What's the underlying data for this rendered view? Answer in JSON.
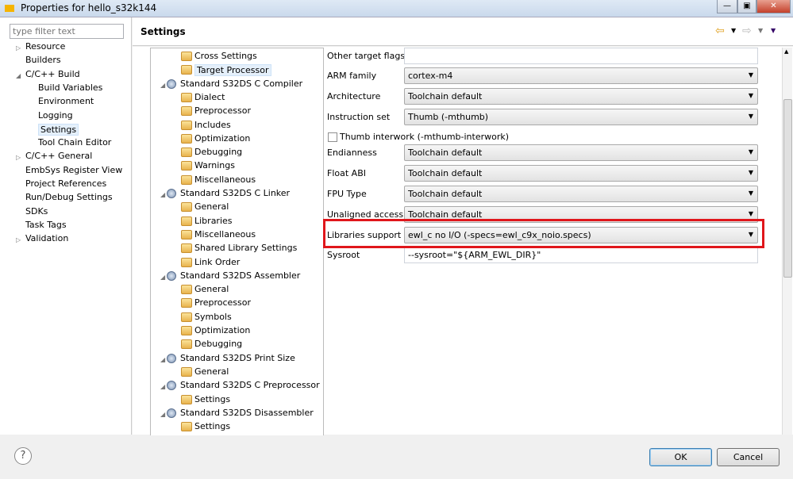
{
  "window": {
    "title": "Properties for hello_s32k144",
    "logo": "NXP"
  },
  "filter": {
    "placeholder": "type filter text"
  },
  "nav": [
    {
      "label": "Resource",
      "level": 0,
      "arrow": "▷"
    },
    {
      "label": "Builders",
      "level": 0,
      "arrow": ""
    },
    {
      "label": "C/C++ Build",
      "level": 0,
      "arrow": "◢"
    },
    {
      "label": "Build Variables",
      "level": 1,
      "arrow": ""
    },
    {
      "label": "Environment",
      "level": 1,
      "arrow": ""
    },
    {
      "label": "Logging",
      "level": 1,
      "arrow": ""
    },
    {
      "label": "Settings",
      "level": 1,
      "arrow": "",
      "selected": true
    },
    {
      "label": "Tool Chain Editor",
      "level": 1,
      "arrow": ""
    },
    {
      "label": "C/C++ General",
      "level": 0,
      "arrow": "▷"
    },
    {
      "label": "EmbSys Register View",
      "level": 0,
      "arrow": ""
    },
    {
      "label": "Project References",
      "level": 0,
      "arrow": ""
    },
    {
      "label": "Run/Debug Settings",
      "level": 0,
      "arrow": ""
    },
    {
      "label": "SDKs",
      "level": 0,
      "arrow": ""
    },
    {
      "label": "Task Tags",
      "level": 0,
      "arrow": ""
    },
    {
      "label": "Validation",
      "level": 0,
      "arrow": "▷"
    }
  ],
  "header": {
    "title": "Settings"
  },
  "tool_tree": [
    {
      "label": "Cross Settings",
      "level": 1,
      "icon": "folder"
    },
    {
      "label": "Target Processor",
      "level": 1,
      "icon": "folder",
      "selected": true
    },
    {
      "label": "Standard S32DS C Compiler",
      "level": 0,
      "icon": "tool"
    },
    {
      "label": "Dialect",
      "level": 1,
      "icon": "folder"
    },
    {
      "label": "Preprocessor",
      "level": 1,
      "icon": "folder"
    },
    {
      "label": "Includes",
      "level": 1,
      "icon": "folder"
    },
    {
      "label": "Optimization",
      "level": 1,
      "icon": "folder"
    },
    {
      "label": "Debugging",
      "level": 1,
      "icon": "folder"
    },
    {
      "label": "Warnings",
      "level": 1,
      "icon": "folder"
    },
    {
      "label": "Miscellaneous",
      "level": 1,
      "icon": "folder"
    },
    {
      "label": "Standard S32DS C Linker",
      "level": 0,
      "icon": "tool"
    },
    {
      "label": "General",
      "level": 1,
      "icon": "folder"
    },
    {
      "label": "Libraries",
      "level": 1,
      "icon": "folder"
    },
    {
      "label": "Miscellaneous",
      "level": 1,
      "icon": "folder"
    },
    {
      "label": "Shared Library Settings",
      "level": 1,
      "icon": "folder"
    },
    {
      "label": "Link Order",
      "level": 1,
      "icon": "folder"
    },
    {
      "label": "Standard S32DS Assembler",
      "level": 0,
      "icon": "tool"
    },
    {
      "label": "General",
      "level": 1,
      "icon": "folder"
    },
    {
      "label": "Preprocessor",
      "level": 1,
      "icon": "folder"
    },
    {
      "label": "Symbols",
      "level": 1,
      "icon": "folder"
    },
    {
      "label": "Optimization",
      "level": 1,
      "icon": "folder"
    },
    {
      "label": "Debugging",
      "level": 1,
      "icon": "folder"
    },
    {
      "label": "Standard S32DS Print Size",
      "level": 0,
      "icon": "tool"
    },
    {
      "label": "General",
      "level": 1,
      "icon": "folder"
    },
    {
      "label": "Standard S32DS C Preprocessor",
      "level": 0,
      "icon": "tool"
    },
    {
      "label": "Settings",
      "level": 1,
      "icon": "folder"
    },
    {
      "label": "Standard S32DS Disassembler",
      "level": 0,
      "icon": "tool"
    },
    {
      "label": "Settings",
      "level": 1,
      "icon": "folder"
    }
  ],
  "form": [
    {
      "label": "Other target flags",
      "type": "text",
      "value": ""
    },
    {
      "label": "ARM family",
      "type": "select",
      "value": "cortex-m4"
    },
    {
      "label": "Architecture",
      "type": "select",
      "value": "Toolchain default"
    },
    {
      "label": "Instruction set",
      "type": "select",
      "value": "Thumb (-mthumb)"
    },
    {
      "label": "Thumb interwork (-mthumb-interwork)",
      "type": "checkbox",
      "value": false
    },
    {
      "label": "Endianness",
      "type": "select",
      "value": "Toolchain default"
    },
    {
      "label": "Float ABI",
      "type": "select",
      "value": "Toolchain default"
    },
    {
      "label": "FPU Type",
      "type": "select",
      "value": "Toolchain default"
    },
    {
      "label": "Unaligned access",
      "type": "select",
      "value": "Toolchain default"
    },
    {
      "label": "Libraries support",
      "type": "select",
      "value": "ewl_c no I/O (-specs=ewl_c9x_noio.specs)",
      "highlighted": true
    },
    {
      "label": "Sysroot",
      "type": "text",
      "value": "--sysroot=\"${ARM_EWL_DIR}\""
    }
  ],
  "buttons": {
    "ok": "OK",
    "cancel": "Cancel",
    "help": "?"
  },
  "colors": {
    "highlight": "#e0161b"
  }
}
